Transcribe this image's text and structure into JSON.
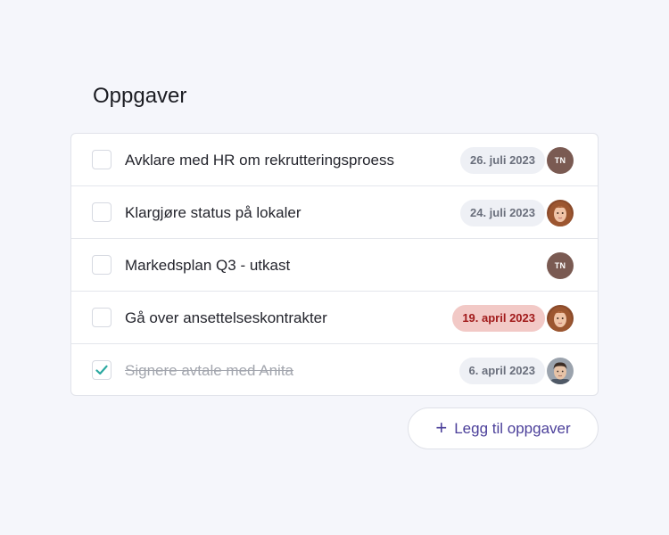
{
  "page": {
    "title": "Oppgaver"
  },
  "tasks": [
    {
      "label": "Avklare med HR om rekrutteringsproess",
      "date": "26. juli 2023",
      "overdue": false,
      "done": false,
      "assignee": {
        "type": "initials",
        "initials": "TN"
      }
    },
    {
      "label": "Klargjøre status på lokaler",
      "date": "24. juli 2023",
      "overdue": false,
      "done": false,
      "assignee": {
        "type": "photo",
        "icon": "woman-avatar-icon"
      }
    },
    {
      "label": "Markedsplan Q3 - utkast",
      "date": "",
      "overdue": false,
      "done": false,
      "assignee": {
        "type": "initials",
        "initials": "TN"
      }
    },
    {
      "label": "Gå over ansettelseskontrakter",
      "date": "19. april 2023",
      "overdue": true,
      "done": false,
      "assignee": {
        "type": "photo",
        "icon": "woman-avatar-icon"
      }
    },
    {
      "label": "Signere avtale med Anita",
      "date": "6. april 2023",
      "overdue": false,
      "done": true,
      "assignee": {
        "type": "photo",
        "icon": "man-avatar-icon"
      }
    }
  ],
  "actions": {
    "add_label": "Legg til oppgaver",
    "add_icon": "plus-icon"
  },
  "colors": {
    "accent": "#4b3f9a",
    "check": "#2aa8a0",
    "overdue_bg": "#f2c9c6",
    "overdue_text": "#a11a1a"
  }
}
